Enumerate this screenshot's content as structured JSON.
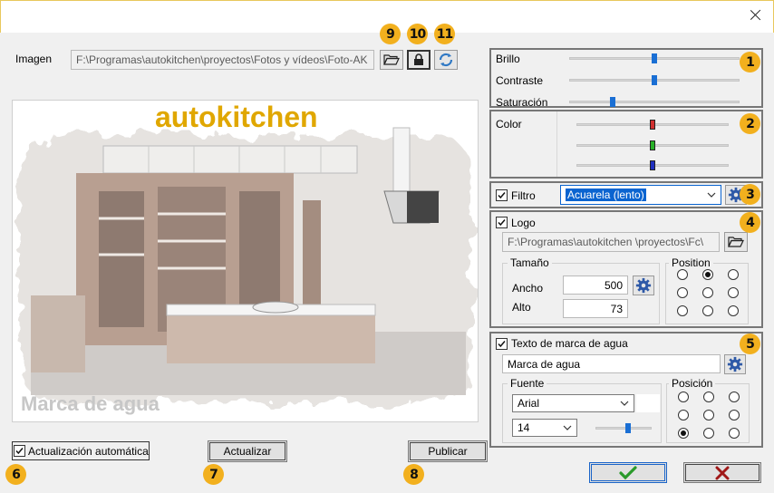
{
  "window": {
    "close_label": ""
  },
  "imagen": {
    "label": "Imagen",
    "path": "F:\\Programas\\autokitchen\\proyectos\\Fotos y vídeos\\Foto-AK"
  },
  "preview": {
    "logo_text": "autokitchen",
    "watermark_text": "Marca de agua"
  },
  "adjust": {
    "brillo_label": "Brillo",
    "contraste_label": "Contraste",
    "saturacion_label": "Saturación",
    "brillo": 0.5,
    "contraste": 0.5,
    "saturacion": 0.25
  },
  "color": {
    "label": "Color",
    "red": 0.5,
    "green": 0.5,
    "blue": 0.5,
    "red_hex": "#d03030",
    "green_hex": "#28b028",
    "blue_hex": "#2030c0"
  },
  "filter": {
    "label": "Filtro",
    "checked": true,
    "selected": "Acuarela (lento)"
  },
  "logo": {
    "label": "Logo",
    "checked": true,
    "path": "F:\\Programas\\autokitchen \\proyectos\\Fc\\",
    "size_label": "Tamaño",
    "ancho_label": "Ancho",
    "ancho": "500",
    "alto_label": "Alto",
    "alto": "73",
    "position_label": "Position",
    "position_selected": 1
  },
  "watermark": {
    "label": "Texto de marca de agua",
    "checked": true,
    "text": "Marca de agua",
    "font_label": "Fuente",
    "font": "Arial",
    "size": "14",
    "opacity": 0.58,
    "position_label": "Posición",
    "position_selected": 6
  },
  "bottom": {
    "auto_update_label": "Actualización automática",
    "auto_update_checked": true,
    "update_label": "Actualizar",
    "publish_label": "Publicar"
  },
  "badges": [
    "1",
    "2",
    "3",
    "4",
    "5",
    "6",
    "7",
    "8",
    "9",
    "10",
    "11"
  ],
  "colors": {
    "accent": "#f2b01e",
    "logo_text": "#e0a700",
    "ok_green": "#2a9a2a",
    "cancel_red": "#a01818",
    "selection_blue": "#0a64d0"
  }
}
